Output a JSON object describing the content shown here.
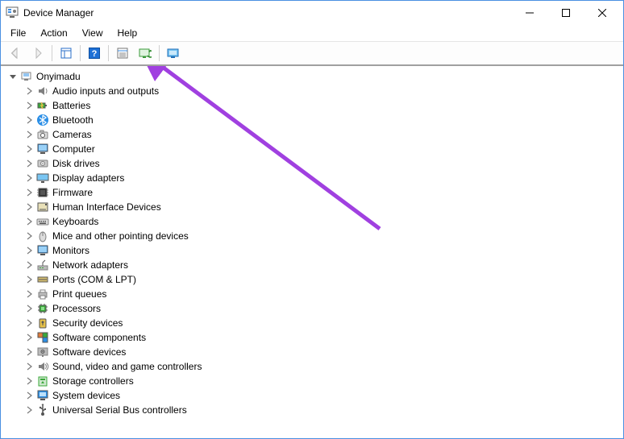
{
  "window": {
    "title": "Device Manager"
  },
  "menu": {
    "items": [
      "File",
      "Action",
      "View",
      "Help"
    ]
  },
  "toolbar": {
    "back": "Back",
    "forward": "Forward",
    "properties": "Properties",
    "help": "Help",
    "scan": "Scan for hardware changes",
    "uninstall": "Uninstall device",
    "add_legacy": "Add legacy hardware"
  },
  "tree": {
    "root": "Onyimadu",
    "categories": [
      {
        "label": "Audio inputs and outputs",
        "icon": "audio"
      },
      {
        "label": "Batteries",
        "icon": "battery"
      },
      {
        "label": "Bluetooth",
        "icon": "bluetooth"
      },
      {
        "label": "Cameras",
        "icon": "camera"
      },
      {
        "label": "Computer",
        "icon": "computer"
      },
      {
        "label": "Disk drives",
        "icon": "disk"
      },
      {
        "label": "Display adapters",
        "icon": "display"
      },
      {
        "label": "Firmware",
        "icon": "firmware"
      },
      {
        "label": "Human Interface Devices",
        "icon": "hid"
      },
      {
        "label": "Keyboards",
        "icon": "keyboard"
      },
      {
        "label": "Mice and other pointing devices",
        "icon": "mouse"
      },
      {
        "label": "Monitors",
        "icon": "monitor"
      },
      {
        "label": "Network adapters",
        "icon": "network"
      },
      {
        "label": "Ports (COM & LPT)",
        "icon": "port"
      },
      {
        "label": "Print queues",
        "icon": "printer"
      },
      {
        "label": "Processors",
        "icon": "cpu"
      },
      {
        "label": "Security devices",
        "icon": "security"
      },
      {
        "label": "Software components",
        "icon": "swcomp"
      },
      {
        "label": "Software devices",
        "icon": "swdev"
      },
      {
        "label": "Sound, video and game controllers",
        "icon": "sound"
      },
      {
        "label": "Storage controllers",
        "icon": "storage"
      },
      {
        "label": "System devices",
        "icon": "system"
      },
      {
        "label": "Universal Serial Bus controllers",
        "icon": "usb"
      }
    ]
  }
}
